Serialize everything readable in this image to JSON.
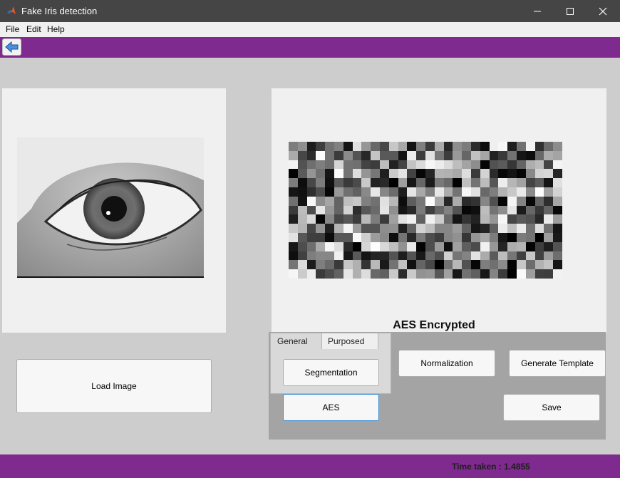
{
  "window": {
    "title": "Fake Iris detection"
  },
  "menu": {
    "items": [
      "File",
      "Edit",
      "Help"
    ]
  },
  "tabs": [
    {
      "label": "General",
      "active": false
    },
    {
      "label": "Purposed",
      "active": true
    }
  ],
  "buttons": {
    "load_image": "Load Image",
    "segmentation": "Segmentation",
    "normalization": "Normalization",
    "generate_template": "Generate Template",
    "aes": "AES",
    "save": "Save"
  },
  "result": {
    "label": "AES Encrypted"
  },
  "status": {
    "time_taken": "Time taken : 1.4855"
  },
  "colors": {
    "accent": "#7e2a8e",
    "panel": "#f0f0f0",
    "controls": "#a4a4a4"
  },
  "icons": [
    "matlab-icon",
    "minimize-icon",
    "maximize-icon",
    "close-icon",
    "back-arrow-icon"
  ]
}
